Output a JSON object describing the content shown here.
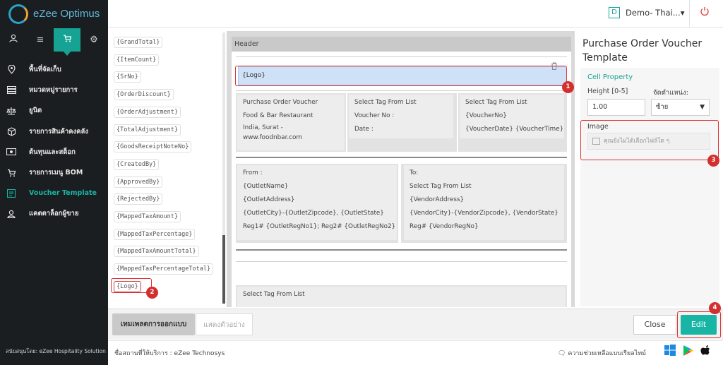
{
  "app": {
    "name": "eZee Optimus"
  },
  "topbar": {
    "property_badge": "D",
    "property_name": "Demo- Thai...▾"
  },
  "sidebar": {
    "tabs": [
      "user",
      "menu",
      "cart",
      "settings"
    ],
    "items": [
      {
        "label": "พื้นที่จัดเก็บ",
        "icon": "location-pin-icon"
      },
      {
        "label": "หมวดหมู่รายการ",
        "icon": "category-icon"
      },
      {
        "label": "ยูนิต",
        "icon": "scale-icon"
      },
      {
        "label": "รายการสินค้าคงคลัง",
        "icon": "box-icon"
      },
      {
        "label": "ต้นทุนและสต็อก",
        "icon": "cash-icon"
      },
      {
        "label": "รายการเมนู BOM",
        "icon": "cart-icon"
      },
      {
        "label": "Voucher Template",
        "icon": "template-icon"
      },
      {
        "label": "แคตตาล็อกผู้ขาย",
        "icon": "vendor-icon"
      }
    ],
    "footer": "สนับสนุนโดย: eZee Hospitality Solution"
  },
  "tags": [
    "{GrandTotal}",
    "{ItemCount}",
    "{SrNo}",
    "{OrderDiscount}",
    "{OrderAdjustment}",
    "{TotalAdjustment}",
    "{GoodsReceiptNoteNo}",
    "{CreatedBy}",
    "{ApprovedBy}",
    "{RejectedBy}",
    "{MappedTaxAmount}",
    "{MappedTaxPercentage}",
    "{MappedTaxAmountTotal}",
    "{MappedTaxPercentageTotal}",
    "{Logo}"
  ],
  "canvas": {
    "header_label": "Header",
    "logo_cell": "{Logo}",
    "block1": {
      "col1": [
        "Purchase Order Voucher",
        "Food & Bar Restaurant",
        "India, Surat -",
        "www.foodnbar.com"
      ],
      "col2": [
        "Select Tag From List",
        "Voucher No :",
        "Date :"
      ],
      "col3": [
        "Select Tag From List",
        "{VoucherNo}",
        "{VoucherDate} {VoucherTime}"
      ]
    },
    "block2": {
      "from": [
        "From :",
        "{OutletName}",
        "{OutletAddress}",
        "{OutletCity}-{OutletZipcode}, {OutletState}",
        "Reg1# {OutletRegNo1}; Reg2# {OutletRegNo2}"
      ],
      "to": [
        "To:",
        "Select Tag From List",
        "{VendorAddress}",
        "{VendorCity}-{VendorZipcode}, {VendorState}",
        "Reg# {VendorRegNo}"
      ]
    },
    "block3": [
      "Select Tag From List"
    ]
  },
  "right_panel": {
    "title": "Purchase Order Voucher Template",
    "cell_property": "Cell Property",
    "height_label": "Height [0-5]",
    "height_value": "1.00",
    "align_label": "จัดตำแหน่ง:",
    "align_value": "ซ้าย",
    "image_label": "Image",
    "image_placeholder": "คุณยังไม่ได้เลือกไฟล์ใด ๆ"
  },
  "bottom": {
    "design_tab": "เทมเพลตการออกแบบ",
    "preview_tab": "แสดงตัวอย่าง",
    "close": "Close",
    "edit": "Edit"
  },
  "footer": {
    "owner": "ชื่อสถานที่ให้บริการ : eZee Technosys",
    "help": "ความช่วยเหลือแบบเรียลไทม์"
  },
  "markers": [
    "1",
    "2",
    "3",
    "4"
  ],
  "colors": {
    "accent": "#16a394",
    "sidebar_bg": "#1b1e20",
    "highlight": "#d33333"
  }
}
